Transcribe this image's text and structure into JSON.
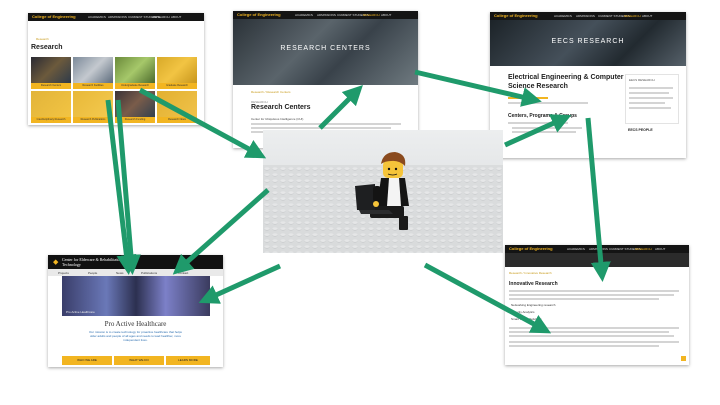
{
  "colors": {
    "arrow": "#1f9a6b",
    "gold": "#f2b521",
    "dark_nav": "#141414",
    "hr_blue": "#2d6fb0"
  },
  "nav": {
    "logo": "College of Engineering",
    "items": [
      "ACADEMICS",
      "ADMISSIONS",
      "CURRENT STUDENTS",
      "RESEARCH",
      "ABOUT"
    ],
    "search": "SEARCH"
  },
  "research_page": {
    "breadcrumb": "Research",
    "title": "Research",
    "tiles": [
      "Research Centers",
      "Research Facilities",
      "Undergraduate Research",
      "Graduate Research",
      "Interdisciplinary Research",
      "Research Publications",
      "Research Funding",
      "Research News"
    ]
  },
  "centers_page": {
    "banner": "RESEARCH CENTERS",
    "breadcrumb": "Research / Research Centers",
    "kicker": "RESEARCH",
    "title": "Research Centers",
    "body_lead": "Center for Ubiquitous Intelligence (CUI)"
  },
  "eecs_page": {
    "banner": "EECS RESEARCH",
    "title": "Electrical Engineering & Computer Science Research",
    "section": "Centers, Programs & Groups",
    "sidebar_heading": "EECS RESEARCH",
    "sidebar_heading2": "EECS PEOPLE"
  },
  "cert_page": {
    "header_title": "Center for Eldercare & Rehabilitation Technology",
    "tabs": [
      "Projects",
      "People",
      "News",
      "Publications",
      "Contact"
    ],
    "photo_caption": "Pro Active Healthcare",
    "heading": "Pro Active Healthcare",
    "mission": "Our mission is to create technology for proactive healthcare that helps older adults and people of all ages and needs to lead healthier, more independent lives.",
    "buttons": [
      "WHO WE ARE",
      "WHAT WE DO",
      "LEARN MORE"
    ]
  },
  "innovative_page": {
    "breadcrumb": "Research / Innovative Research",
    "title": "Innovative Research",
    "bullets": [
      "Networking Engineering research",
      "Security Analytics",
      "Smart Health Solutions"
    ],
    "nav_research": "RESEARCH"
  },
  "photo": {
    "subject": "lego-minifigure-with-laptop"
  }
}
